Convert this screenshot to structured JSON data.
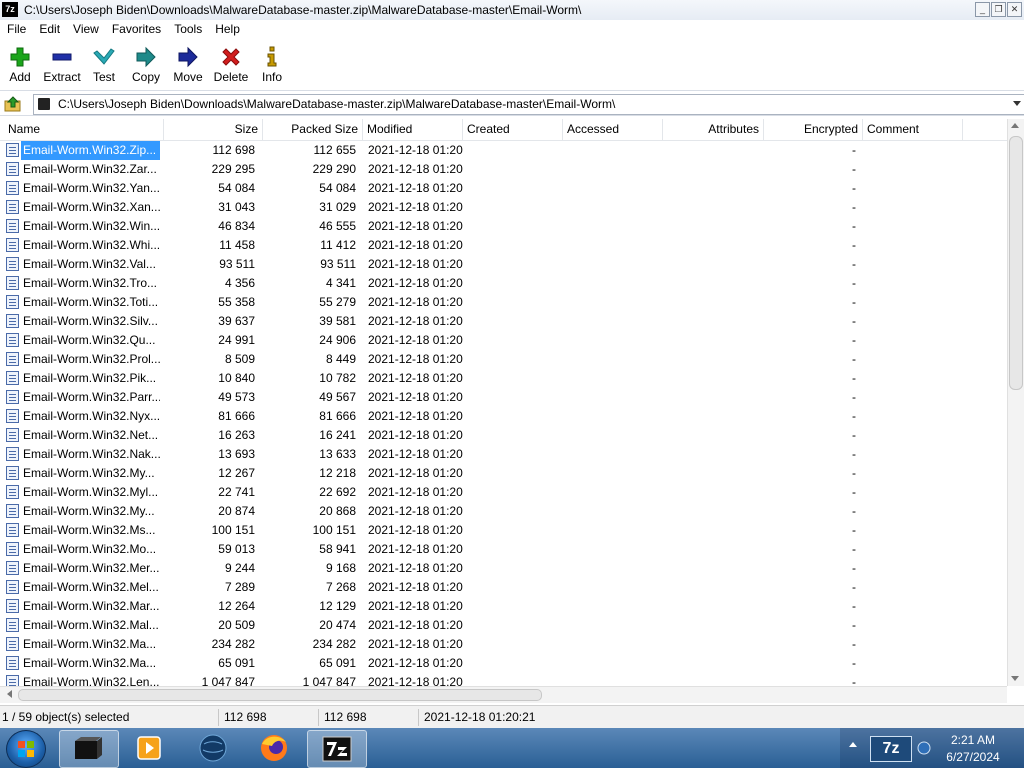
{
  "window": {
    "title": "C:\\Users\\Joseph Biden\\Downloads\\MalwareDatabase-master.zip\\MalwareDatabase-master\\Email-Worm\\",
    "app_icon_label": "7z",
    "minimize_glyph": "_",
    "maximize_glyph": "❐",
    "close_glyph": "✕"
  },
  "menu": [
    "File",
    "Edit",
    "View",
    "Favorites",
    "Tools",
    "Help"
  ],
  "toolbar": {
    "add": "Add",
    "extract": "Extract",
    "test": "Test",
    "copy": "Copy",
    "move": "Move",
    "delete": "Delete",
    "info": "Info"
  },
  "address": {
    "path": "C:\\Users\\Joseph Biden\\Downloads\\MalwareDatabase-master.zip\\MalwareDatabase-master\\Email-Worm\\"
  },
  "columns": {
    "name": "Name",
    "size": "Size",
    "packed": "Packed Size",
    "modified": "Modified",
    "created": "Created",
    "accessed": "Accessed",
    "attributes": "Attributes",
    "encrypted": "Encrypted",
    "comment": "Comment"
  },
  "rows": [
    {
      "name": "Email-Worm.Win32.Zip...",
      "size": "112 698",
      "packed": "112 655",
      "modified": "2021-12-18 01:20",
      "encrypted": "-"
    },
    {
      "name": "Email-Worm.Win32.Zar...",
      "size": "229 295",
      "packed": "229 290",
      "modified": "2021-12-18 01:20",
      "encrypted": "-"
    },
    {
      "name": "Email-Worm.Win32.Yan...",
      "size": "54 084",
      "packed": "54 084",
      "modified": "2021-12-18 01:20",
      "encrypted": "-"
    },
    {
      "name": "Email-Worm.Win32.Xan...",
      "size": "31 043",
      "packed": "31 029",
      "modified": "2021-12-18 01:20",
      "encrypted": "-"
    },
    {
      "name": "Email-Worm.Win32.Win...",
      "size": "46 834",
      "packed": "46 555",
      "modified": "2021-12-18 01:20",
      "encrypted": "-"
    },
    {
      "name": "Email-Worm.Win32.Whi...",
      "size": "11 458",
      "packed": "11 412",
      "modified": "2021-12-18 01:20",
      "encrypted": "-"
    },
    {
      "name": "Email-Worm.Win32.Val...",
      "size": "93 511",
      "packed": "93 511",
      "modified": "2021-12-18 01:20",
      "encrypted": "-"
    },
    {
      "name": "Email-Worm.Win32.Tro...",
      "size": "4 356",
      "packed": "4 341",
      "modified": "2021-12-18 01:20",
      "encrypted": "-"
    },
    {
      "name": "Email-Worm.Win32.Toti...",
      "size": "55 358",
      "packed": "55 279",
      "modified": "2021-12-18 01:20",
      "encrypted": "-"
    },
    {
      "name": "Email-Worm.Win32.Silv...",
      "size": "39 637",
      "packed": "39 581",
      "modified": "2021-12-18 01:20",
      "encrypted": "-"
    },
    {
      "name": "Email-Worm.Win32.Qu...",
      "size": "24 991",
      "packed": "24 906",
      "modified": "2021-12-18 01:20",
      "encrypted": "-"
    },
    {
      "name": "Email-Worm.Win32.Prol...",
      "size": "8 509",
      "packed": "8 449",
      "modified": "2021-12-18 01:20",
      "encrypted": "-"
    },
    {
      "name": "Email-Worm.Win32.Pik...",
      "size": "10 840",
      "packed": "10 782",
      "modified": "2021-12-18 01:20",
      "encrypted": "-"
    },
    {
      "name": "Email-Worm.Win32.Parr...",
      "size": "49 573",
      "packed": "49 567",
      "modified": "2021-12-18 01:20",
      "encrypted": "-"
    },
    {
      "name": "Email-Worm.Win32.Nyx...",
      "size": "81 666",
      "packed": "81 666",
      "modified": "2021-12-18 01:20",
      "encrypted": "-"
    },
    {
      "name": "Email-Worm.Win32.Net...",
      "size": "16 263",
      "packed": "16 241",
      "modified": "2021-12-18 01:20",
      "encrypted": "-"
    },
    {
      "name": "Email-Worm.Win32.Nak...",
      "size": "13 693",
      "packed": "13 633",
      "modified": "2021-12-18 01:20",
      "encrypted": "-"
    },
    {
      "name": "Email-Worm.Win32.My...",
      "size": "12 267",
      "packed": "12 218",
      "modified": "2021-12-18 01:20",
      "encrypted": "-"
    },
    {
      "name": "Email-Worm.Win32.Myl...",
      "size": "22 741",
      "packed": "22 692",
      "modified": "2021-12-18 01:20",
      "encrypted": "-"
    },
    {
      "name": "Email-Worm.Win32.My...",
      "size": "20 874",
      "packed": "20 868",
      "modified": "2021-12-18 01:20",
      "encrypted": "-"
    },
    {
      "name": "Email-Worm.Win32.Ms...",
      "size": "100 151",
      "packed": "100 151",
      "modified": "2021-12-18 01:20",
      "encrypted": "-"
    },
    {
      "name": "Email-Worm.Win32.Mo...",
      "size": "59 013",
      "packed": "58 941",
      "modified": "2021-12-18 01:20",
      "encrypted": "-"
    },
    {
      "name": "Email-Worm.Win32.Mer...",
      "size": "9 244",
      "packed": "9 168",
      "modified": "2021-12-18 01:20",
      "encrypted": "-"
    },
    {
      "name": "Email-Worm.Win32.Mel...",
      "size": "7 289",
      "packed": "7 268",
      "modified": "2021-12-18 01:20",
      "encrypted": "-"
    },
    {
      "name": "Email-Worm.Win32.Mar...",
      "size": "12 264",
      "packed": "12 129",
      "modified": "2021-12-18 01:20",
      "encrypted": "-"
    },
    {
      "name": "Email-Worm.Win32.Mal...",
      "size": "20 509",
      "packed": "20 474",
      "modified": "2021-12-18 01:20",
      "encrypted": "-"
    },
    {
      "name": "Email-Worm.Win32.Ma...",
      "size": "234 282",
      "packed": "234 282",
      "modified": "2021-12-18 01:20",
      "encrypted": "-"
    },
    {
      "name": "Email-Worm.Win32.Ma...",
      "size": "65 091",
      "packed": "65 091",
      "modified": "2021-12-18 01:20",
      "encrypted": "-"
    },
    {
      "name": "Email-Worm.Win32.Len...",
      "size": "1 047 847",
      "packed": "1 047 847",
      "modified": "2021-12-18 01:20",
      "encrypted": "-"
    }
  ],
  "status": {
    "selection": "1 / 59 object(s) selected",
    "size": "112 698",
    "packed": "112 698",
    "modified": "2021-12-18 01:20:21"
  },
  "taskbar": {
    "items": [
      "start-orb",
      "terminal-icon",
      "media-player-icon",
      "globe-icon",
      "firefox-icon",
      "7zip-icon"
    ],
    "tray_app_label": "7z",
    "time": "2:21 AM",
    "date": "6/27/2024"
  },
  "colors": {
    "selection": "#3399ff",
    "add_icon": "#1aa51a",
    "extract_icon": "#2030a8",
    "test_icon": "#2aa9b5",
    "copy_icon": "#1e8a8a",
    "move_icon": "#1c2a9a",
    "delete_icon": "#d21d1d",
    "info_icon": "#c79a00"
  }
}
